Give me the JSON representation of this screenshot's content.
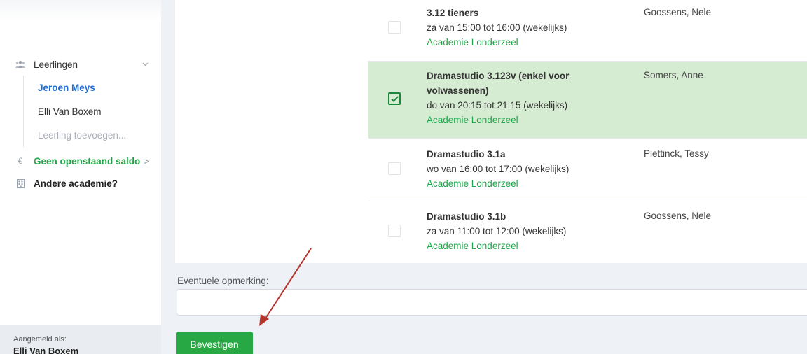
{
  "sidebar": {
    "leerlingen_label": "Leerlingen",
    "students": [
      {
        "name": "Jeroen Meys",
        "active": true
      },
      {
        "name": "Elli Van Boxem",
        "active": false
      }
    ],
    "add_student_label": "Leerling toevoegen...",
    "saldo_label": "Geen openstaand saldo",
    "saldo_arrow": ">",
    "other_academy_label": "Andere academie?",
    "logged_in_as_label": "Aangemeld als:",
    "logged_in_user": "Elli Van Boxem"
  },
  "courses": [
    {
      "title": "3.12 tieners",
      "time": "za van 15:00 tot 16:00 (wekelijks)",
      "location": "Academie Londerzeel",
      "teacher": "Goossens, Nele",
      "checked": false
    },
    {
      "title": "Dramastudio 3.123v (enkel voor volwassenen)",
      "time": "do van 20:15 tot 21:15 (wekelijks)",
      "location": "Academie Londerzeel",
      "teacher": "Somers, Anne",
      "checked": true
    },
    {
      "title": "Dramastudio 3.1a",
      "time": "wo van 16:00 tot 17:00 (wekelijks)",
      "location": "Academie Londerzeel",
      "teacher": "Plettinck, Tessy",
      "checked": false
    },
    {
      "title": "Dramastudio 3.1b",
      "time": "za van 11:00 tot 12:00 (wekelijks)",
      "location": "Academie Londerzeel",
      "teacher": "Goossens, Nele",
      "checked": false
    }
  ],
  "form": {
    "remark_label": "Eventuele opmerking:",
    "remark_value": "",
    "confirm_label": "Bevestigen"
  },
  "colors": {
    "accent_green": "#28a745",
    "link_green": "#1fa64a",
    "active_blue": "#1f6fd1",
    "selected_row": "#d6ecd2",
    "annotation_arrow": "#b5332b"
  }
}
